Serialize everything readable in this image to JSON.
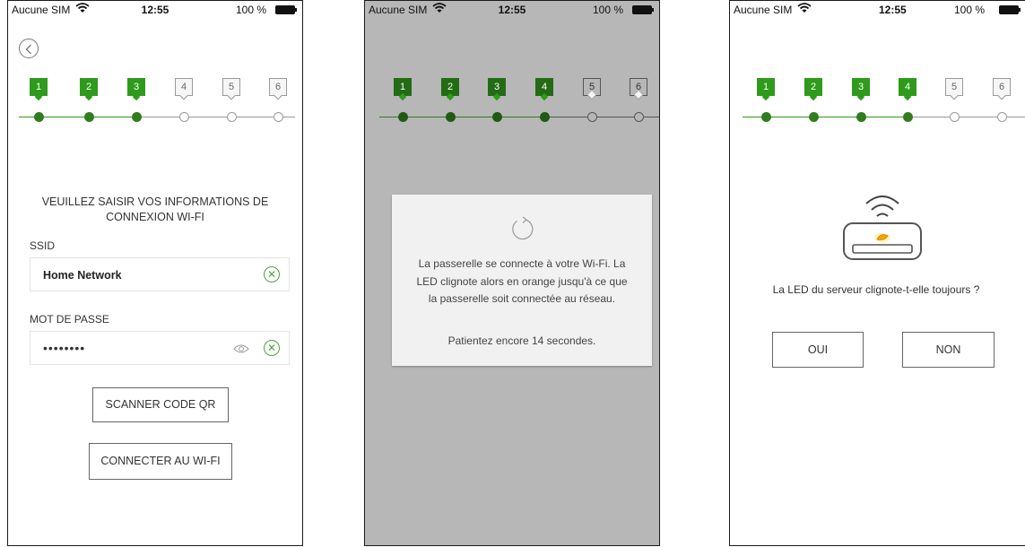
{
  "status": {
    "carrier": "Aucune SIM",
    "time": "12:55",
    "battery": "100 %"
  },
  "steps": [
    "1",
    "2",
    "3",
    "4",
    "5",
    "6"
  ],
  "screen1": {
    "heading_line1": "VEUILLEZ SAISIR VOS INFORMATIONS DE",
    "heading_line2": "CONNEXION WI-FI",
    "ssid_label": "SSID",
    "ssid_value": "Home Network",
    "password_label": "MOT DE PASSE",
    "password_value": "••••••••",
    "scan_button": "SCANNER CODE QR",
    "connect_button": "CONNECTER AU WI-FI",
    "completed_steps": 3
  },
  "screen2": {
    "dialog_line1": "La passerelle se connecte à votre Wi-Fi. La",
    "dialog_line2": "LED clignote alors en orange jusqu'à ce que",
    "dialog_line3": "la passerelle soit connectée au réseau.",
    "wait_text": "Patientez encore 14 secondes.",
    "completed_steps": 4
  },
  "screen3": {
    "question": "La LED du serveur clignote-t-elle toujours ?",
    "yes_button": "OUI",
    "no_button": "NON",
    "completed_steps": 4
  },
  "colors": {
    "accent": "#2f9a1b",
    "overlay": "#b7b7b7",
    "led": "#f2a700"
  },
  "icons": [
    "back-chevron-icon",
    "wifi-icon",
    "clear-icon",
    "eye-icon",
    "refresh-icon",
    "router-icon"
  ]
}
